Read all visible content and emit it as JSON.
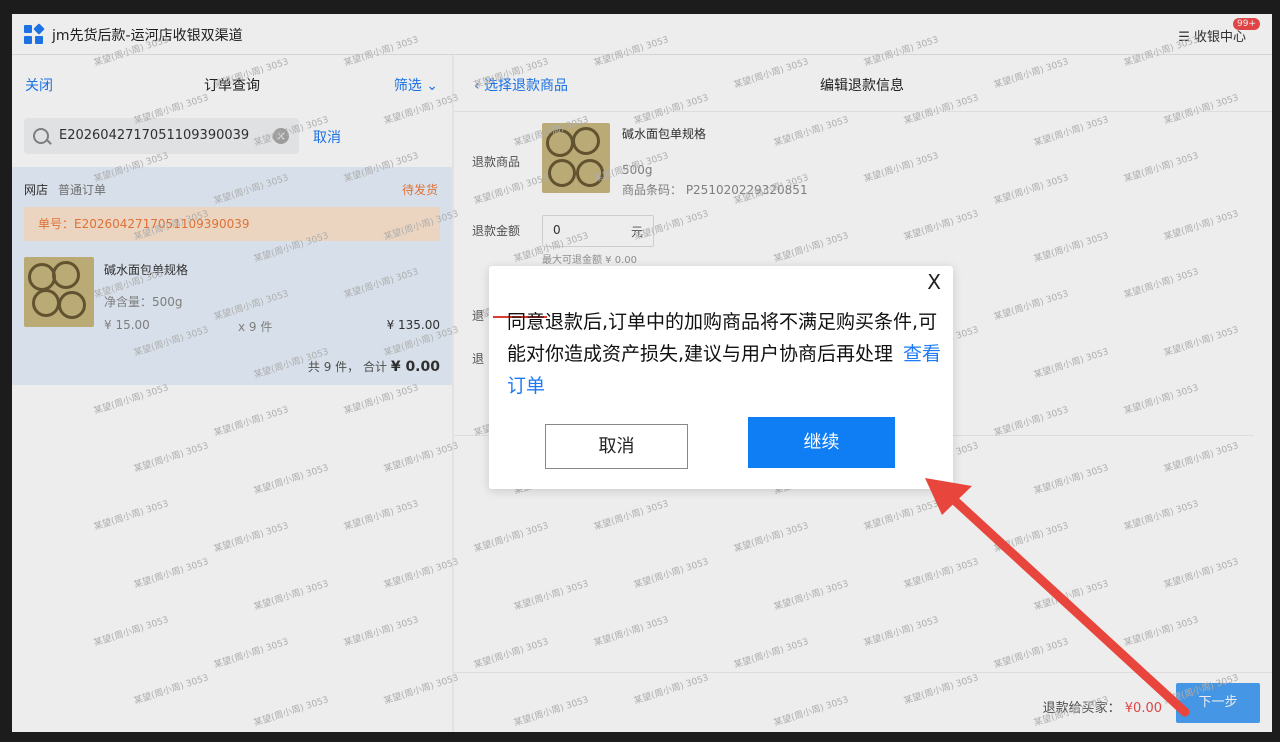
{
  "app": {
    "title": "jm先货后款-运河店收银双渠道",
    "cashier_label": "☰ 收银中心",
    "badge": "99+"
  },
  "left": {
    "close": "关闭",
    "title": "订单查询",
    "filter": "筛选",
    "search_value": "E2026042717051109390039",
    "search_cancel": "取消",
    "order": {
      "shop": "网店",
      "type": "普通订单",
      "status": "待发货",
      "number": "单号：E2026042717051109390039",
      "product_name": "碱水面包单规格",
      "spec": "净含量：500g",
      "price": "¥ 15.00",
      "qty": "x 9 件",
      "subtotal": "¥ 135.00",
      "total_prefix": "共 9 件， 合计",
      "total_amount": "¥ 0.00"
    }
  },
  "right": {
    "back": "选择退款商品",
    "title": "编辑退款信息",
    "label_product": "退款商品",
    "product_name": "碱水面包单规格",
    "product_spec": "500g",
    "product_code": "商品条码：  P251020229320851",
    "label_amount": "退款金额",
    "amount_value": "0",
    "amount_unit": "元",
    "max_refund": "最大可退金额 ¥ 0.00",
    "label_partial_1": "退",
    "label_partial_2": "退",
    "refund_label": "退款给买家：",
    "refund_amount": "¥0.00",
    "next": "下一步"
  },
  "watermark": "某望(周小周) 3053",
  "dialog": {
    "close": "X",
    "message": "同意退款后,订单中的加购商品将不满足购买条件,可能对你造成资产损失,建议与用户协商后再处理",
    "view_order": "查看订单",
    "cancel": "取消",
    "continue": "继续"
  },
  "colors": {
    "accent": "#1f7af5",
    "primary_button": "#0f7df3",
    "warning": "#f07a3a",
    "annotation_red": "#e8453c"
  }
}
